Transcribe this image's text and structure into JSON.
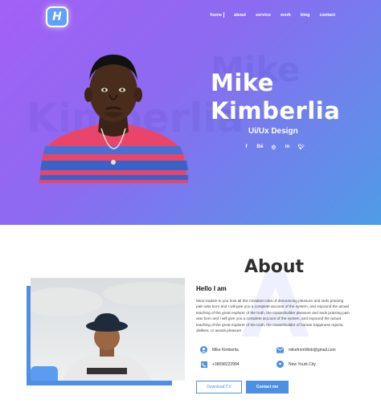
{
  "colors": {
    "accent": "#4d8fe3",
    "gradient_start": "#a35ff6",
    "gradient_end": "#4f9ce6",
    "title": "#2e2e2e"
  },
  "header": {
    "logo_letter": "H",
    "nav": [
      "home",
      "about",
      "service",
      "work",
      "blog",
      "contact"
    ]
  },
  "hero": {
    "ghost_text_1": "Mike",
    "ghost_text_2": "Kimberlia",
    "name_line1": "Mike",
    "name_line2": "Kimberlia",
    "role": "Ui/Ux Design",
    "socials": [
      {
        "icon": "facebook-icon",
        "glyph": "f"
      },
      {
        "icon": "behance-icon",
        "glyph": "Bē"
      },
      {
        "icon": "instagram-icon",
        "glyph": "◎"
      },
      {
        "icon": "linkedin-icon",
        "glyph": "in"
      },
      {
        "icon": "twitter-icon",
        "glyph": "🐦︎"
      }
    ]
  },
  "about": {
    "title": "About",
    "background_letter": "A",
    "hello": "Hello I am",
    "paragraph": "Must explain to you how all this mistaken idea of denouncing pleasure and seds praising pain was born and I will give you a complete account of the system, and expound the actual teaching of the great explorer of the truth, the masterbuilder pleasure and seds praising pain was born and I will give you a complete account of the system, and expound the actual teaching of the great explorer of the truth, the masterbuilder of human happiness rejects, dislikes, or avoids pleasure",
    "contacts": {
      "name": "Mike Kimberlia",
      "email": "mikefromWeb@gmail.com",
      "phone": "+38098222984",
      "location": "New Yourk City"
    },
    "download_cv": "Download CV",
    "contact_me": "Contact me"
  }
}
